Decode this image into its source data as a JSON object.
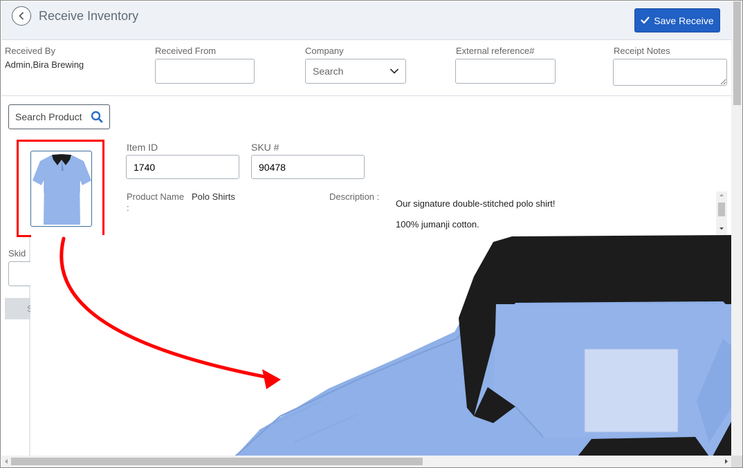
{
  "header": {
    "title": "Receive Inventory",
    "save_label": "Save Receive",
    "back_icon": "chevron-left-icon",
    "save_icon": "check-icon"
  },
  "form": {
    "received_by": {
      "label": "Received By",
      "value": "Admin,Bira Brewing"
    },
    "received_from": {
      "label": "Received From",
      "value": ""
    },
    "company": {
      "label": "Company",
      "placeholder": "Search"
    },
    "external_reference": {
      "label": "External reference#",
      "value": ""
    },
    "receipt_notes": {
      "label": "Receipt Notes",
      "value": ""
    }
  },
  "product": {
    "search_label": "Search Product",
    "item_id": {
      "label": "Item ID",
      "value": "1740"
    },
    "sku": {
      "label": "SKU #",
      "value": "90478"
    },
    "product_name": {
      "label": "Product Name",
      "value": "Polo Shirts",
      "colon": ":"
    },
    "description": {
      "label": "Description :",
      "lines": [
        "Our signature double-stitched polo shirt!",
        "100% jumanji cotton."
      ]
    }
  },
  "skid": {
    "label": "Skid",
    "button_partial": "S"
  },
  "colors": {
    "accent": "#2160c4",
    "highlight": "#ff0000",
    "shirt": "#8fb0e8",
    "collar": "#1a1a1a"
  }
}
